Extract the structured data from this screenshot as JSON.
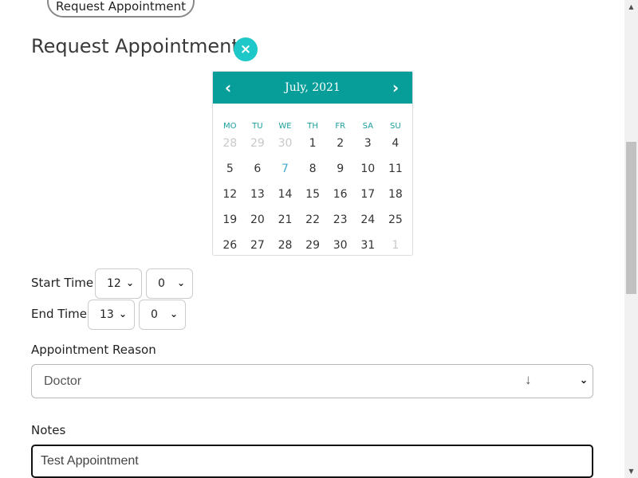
{
  "top_button": {
    "label": "Request Appointment"
  },
  "title": "Request Appointment",
  "close_icon": "×",
  "calendar": {
    "month_label": "July, 2021",
    "prev_icon": "‹",
    "next_icon": "›",
    "weekdays": [
      "MO",
      "TU",
      "WE",
      "TH",
      "FR",
      "SA",
      "SU"
    ],
    "days": [
      [
        "28",
        "29",
        "30",
        "1",
        "2",
        "3",
        "4"
      ],
      [
        "5",
        "6",
        "7",
        "8",
        "9",
        "10",
        "11"
      ],
      [
        "12",
        "13",
        "14",
        "15",
        "16",
        "17",
        "18"
      ],
      [
        "19",
        "20",
        "21",
        "22",
        "23",
        "24",
        "25"
      ],
      [
        "26",
        "27",
        "28",
        "29",
        "30",
        "31",
        "1"
      ]
    ]
  },
  "start_time": {
    "label": "Start Time",
    "hour": "12",
    "minute": "0"
  },
  "end_time": {
    "label": "End Time",
    "hour": "13",
    "minute": "0"
  },
  "reason": {
    "label": "Appointment Reason",
    "value": "Doctor"
  },
  "notes": {
    "label": "Notes",
    "value": "Test Appointment"
  },
  "colors": {
    "accent": "#079e99",
    "close_button": "#1fc8c8",
    "today": "#3fa9c9",
    "muted_day": "#c8c8c8"
  }
}
